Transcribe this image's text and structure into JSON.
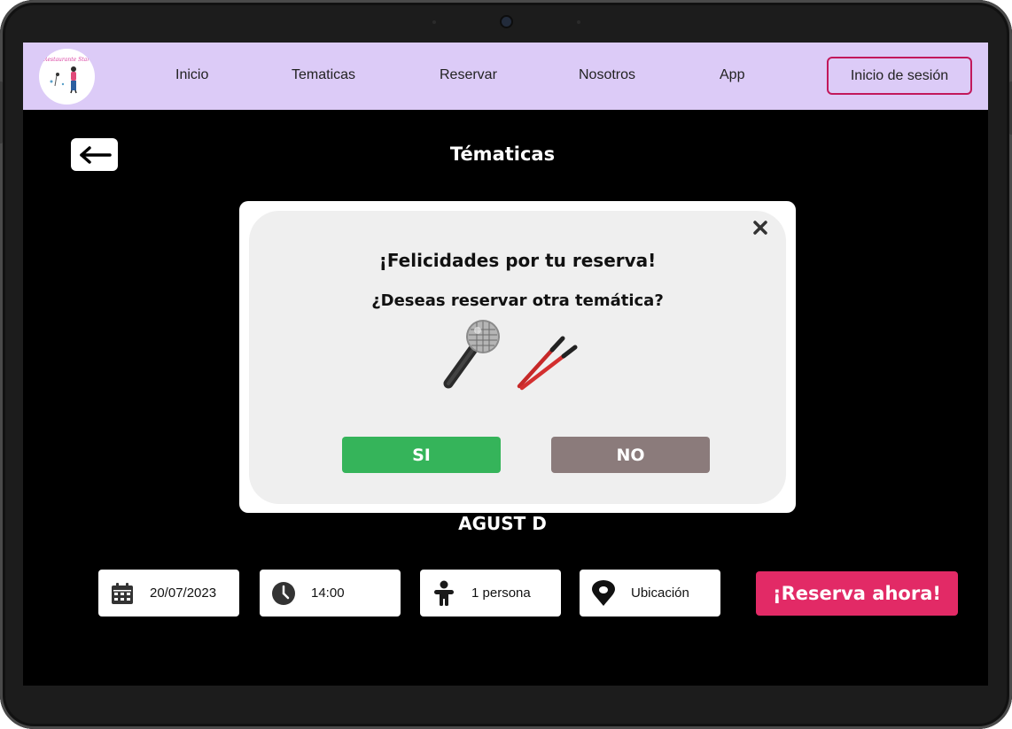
{
  "navbar": {
    "logo_text": "Restaurante Star",
    "links": [
      "Inicio",
      "Tematicas",
      "Reservar",
      "Nosotros",
      "App"
    ],
    "login_label": "Inicio de sesión",
    "background": "#dccbf7",
    "login_border": "#c2185b"
  },
  "page": {
    "title": "Tématicas",
    "back_icon": "arrow-left-icon",
    "artist_name": "AGUST D"
  },
  "modal": {
    "title": "¡Felicidades por tu reserva!",
    "question": "¿Deseas reservar otra temática?",
    "icons": [
      "microphone-icon",
      "drumsticks-icon"
    ],
    "close_icon": "close-icon",
    "yes_label": "SI",
    "no_label": "NO",
    "yes_color": "#35b45a",
    "no_color": "#8b7b7b"
  },
  "filters": {
    "date": "20/07/2023",
    "time": "14:00",
    "people": "1 persona",
    "location": "Ubicación",
    "icons": [
      "calendar-icon",
      "clock-icon",
      "person-icon",
      "location-pin-icon"
    ]
  },
  "cta": {
    "label": "¡Reserva ahora!",
    "color": "#e22a66"
  }
}
